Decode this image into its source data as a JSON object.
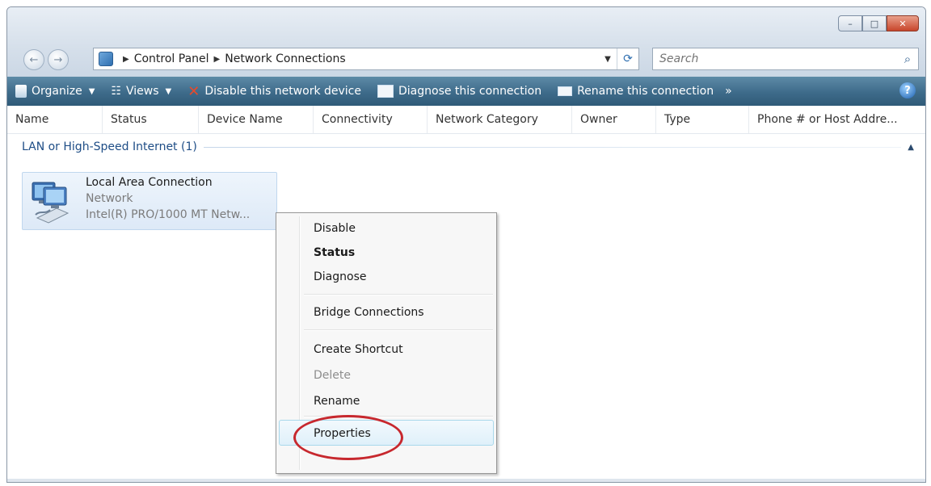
{
  "window": {
    "caption": {
      "minimize": "–",
      "maximize": "□",
      "close": "✕"
    }
  },
  "nav": {
    "back_icon": "←",
    "forward_icon": "→",
    "breadcrumb": [
      "Control Panel",
      "Network Connections"
    ],
    "breadcrumb_sep": "▶",
    "dropdown": "▼",
    "refresh_icon": "⟳"
  },
  "search": {
    "placeholder": "Search",
    "icon": "⌕"
  },
  "toolbar": {
    "organize": "Organize",
    "views": "Views",
    "disable": "Disable this network device",
    "diagnose": "Diagnose this connection",
    "rename": "Rename this connection",
    "more": "»",
    "help": "?"
  },
  "columns": [
    "Name",
    "Status",
    "Device Name",
    "Connectivity",
    "Network Category",
    "Owner",
    "Type",
    "Phone # or Host Addre..."
  ],
  "group": {
    "label": "LAN or High-Speed Internet (1)",
    "collapse": "▲"
  },
  "item": {
    "name": "Local Area Connection",
    "status": "Network",
    "device": "Intel(R) PRO/1000 MT Netw..."
  },
  "menu": {
    "items": [
      "Disable",
      "Status",
      "Diagnose",
      "Bridge Connections",
      "Create Shortcut",
      "Delete",
      "Rename",
      "Properties"
    ]
  },
  "annotation": {
    "highlight_color": "#c7282e"
  }
}
